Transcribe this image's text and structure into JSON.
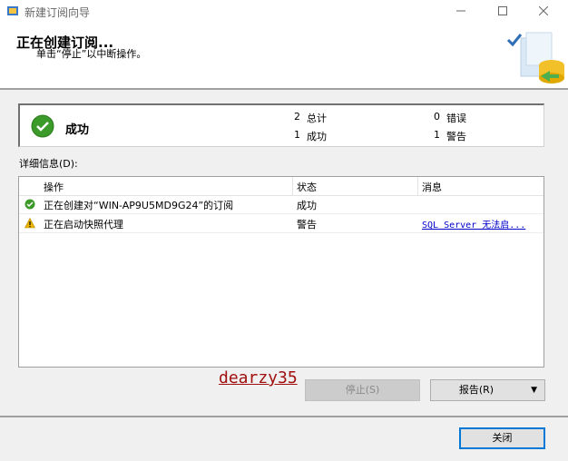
{
  "window": {
    "title": "新建订阅向导"
  },
  "header": {
    "title": "正在创建订阅...",
    "subtitle": "单击“停止”以中断操作。"
  },
  "summary": {
    "status": "成功",
    "counts": [
      {
        "num": "2",
        "label": "总计"
      },
      {
        "num": "0",
        "label": "错误"
      },
      {
        "num": "1",
        "label": "成功"
      },
      {
        "num": "1",
        "label": "警告"
      }
    ]
  },
  "details": {
    "label": "详细信息(D):",
    "columns": [
      "操作",
      "状态",
      "消息"
    ],
    "rows": [
      {
        "icon": "success-icon",
        "action": "正在创建对“WIN-AP9U5MD9G24”的订阅",
        "status": "成功",
        "message": ""
      },
      {
        "icon": "warning-icon",
        "action": "正在启动快照代理",
        "status": "警告",
        "message": "SQL Server 无法启..."
      }
    ]
  },
  "watermark": "dearzy35",
  "buttons": {
    "stop": "停止(S)",
    "report": "报告(R)",
    "close": "关闭"
  },
  "colors": {
    "success": "#3c9a2a",
    "warning": "#e8b400",
    "link": "#0000cc",
    "focus": "#0078d7"
  }
}
